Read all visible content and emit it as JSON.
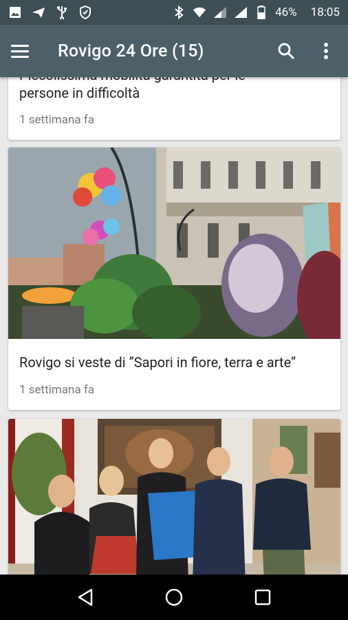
{
  "status_bar": {
    "battery": "46%",
    "time": "18:05",
    "left_icons": [
      "image-icon",
      "send-icon",
      "usb-icon",
      "shield-icon"
    ],
    "right_icons": [
      "bluetooth-icon",
      "wifi-icon",
      "signal-icon",
      "signal-icon",
      "battery-icon"
    ]
  },
  "app_bar": {
    "title": "Rovigo 24 Ore (15)",
    "icons": [
      "menu-icon",
      "search-icon",
      "more-vert-icon"
    ]
  },
  "feed": {
    "articles": [
      {
        "title_line1": "Piccolissima mobilità garantita per le",
        "title_line2": "persone in difficoltà",
        "time": "1 settimana fa"
      },
      {
        "title": "Rovigo si veste di ”Sapori in fiore, terra e arte”",
        "time": "1 settimana fa",
        "image": "street-flower-market-photo"
      },
      {
        "image": "group-photo-blue-shirt"
      }
    ]
  },
  "nav_bar": {
    "icons": [
      "back-icon",
      "home-icon",
      "recents-icon"
    ]
  },
  "colors": {
    "status_bar": "#3e4e55",
    "app_bar": "#4d6069",
    "background": "#e9e9e9"
  }
}
